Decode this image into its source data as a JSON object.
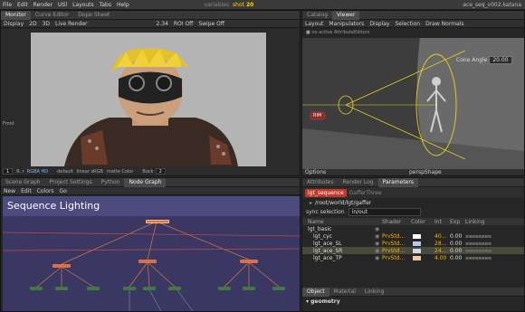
{
  "title": "ace_seq_v002.katana",
  "menu": [
    "File",
    "Edit",
    "Render",
    "Util",
    "Layouts",
    "Tabs",
    "Help"
  ],
  "toolbar": {
    "variables": "variables",
    "shot_label": "shot",
    "shot_value": "20"
  },
  "monitor": {
    "tabs": [
      "Monitor",
      "Curve Editor",
      "Dope Sheet"
    ],
    "tools": [
      "Display",
      "2D",
      "3D",
      "Live Render"
    ],
    "readouts": [
      "2.34",
      "ROI Off",
      "Swipe Off"
    ],
    "front_label": "Front",
    "bottom_left": [
      "R..r",
      "RGBA HD"
    ],
    "bottom_mid": [
      "default",
      "linear sRGB",
      "matte Color"
    ],
    "bottom_right": [
      "Back",
      "2",
      "default",
      "linear sRGB",
      "matte Color"
    ],
    "frame_start": "1"
  },
  "viewer": {
    "tabs": [
      "Catalog",
      "Viewer"
    ],
    "menus": [
      "Layout",
      "Manipulators",
      "Display",
      "Selection",
      "Draw Normals"
    ],
    "status": "no active AttributeEditors",
    "cone_label": "Cone Angle",
    "cone_value": "20.00",
    "rim_label": "RIM",
    "options": "Options",
    "camera": "perspShape"
  },
  "nodegraph": {
    "tabs": [
      "Scene Graph",
      "Project Settings",
      "Python",
      "Node Graph"
    ],
    "menus": [
      "New",
      "Edit",
      "Colors",
      "Go"
    ],
    "title": "Sequence Lighting"
  },
  "params": {
    "tabs": [
      "Attributes",
      "Render Log",
      "Parameters"
    ],
    "node_name": "lgt_sequence",
    "node_type": "GafferThree",
    "path": "/root/world/lgt/gaffer",
    "sync_label": "sync selection",
    "sync_value": "in/out",
    "columns": [
      "Name",
      "Shader",
      "Color",
      "Int",
      "Exp",
      "Linking"
    ],
    "rows": [
      {
        "name": "lgt_basic",
        "shader": "",
        "color": "",
        "int": "",
        "exp": ""
      },
      {
        "name": "lgt_cyc",
        "shader": "PrvStd...",
        "color": "#ffffff",
        "int": "40...",
        "exp": "0.00"
      },
      {
        "name": "lgt_ace_SL",
        "shader": "PrvStd...",
        "color": "#b7c9e8",
        "int": "28...",
        "exp": "0.00"
      },
      {
        "name": "lgt_ace_SR",
        "shader": "PrvStd...",
        "color": "#cfd8ea",
        "int": "24...",
        "exp": "0.00"
      },
      {
        "name": "lgt_ace_TP",
        "shader": "PrvStd...",
        "color": "#f0c9a0",
        "int": "4.00",
        "exp": "0.00"
      }
    ],
    "subtabs": [
      "Object",
      "Material",
      "Linking"
    ],
    "group": "geometry"
  }
}
